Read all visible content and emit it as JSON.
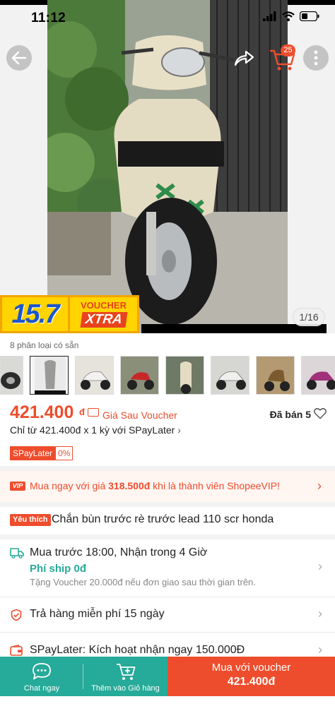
{
  "status_bar": {
    "time": "11:12"
  },
  "header": {
    "cart_count": "25"
  },
  "hero": {
    "promo_date": "15.7",
    "promo_voucher_top": "VOUCHER",
    "promo_voucher_bottom": "XTRA",
    "image_counter": "1/16"
  },
  "variants": {
    "label": "8 phân loại có sẵn"
  },
  "price": {
    "amount": "421.400",
    "currency": "đ",
    "after_voucher_label": "Giá Sau Voucher",
    "sold": "Đã bán 5",
    "installment": "Chỉ từ 421.400đ x 1 kỳ với SPayLater",
    "spaylater_badge": "SPayLater",
    "spaylater_rate": "0%"
  },
  "vip": {
    "tag": "VIP",
    "text_before": "Mua ngay với giá ",
    "price": "318.500đ",
    "text_after": " khi là thành viên ShopeeVIP!"
  },
  "product": {
    "fav_tag": "Yêu thích",
    "title": "Chắn bùn trước rè trước lead 110 scr honda"
  },
  "shipping": {
    "line1": "Mua trước 18:00, Nhận trong 4 Giờ",
    "fee": "Phí ship 0đ",
    "note": "Tặng Voucher 20.000đ nếu đơn giao sau thời gian trên."
  },
  "returns": {
    "text": "Trả hàng miễn phí 15 ngày"
  },
  "spaylater_row": {
    "text": "SPayLater: Kích hoạt nhận ngay 150.000Đ"
  },
  "bottom_bar": {
    "chat_label": "Chat ngay",
    "cart_label": "Thêm vào Giỏ hàng",
    "buy_line1": "Mua với voucher",
    "buy_line2": "421.400đ"
  },
  "colors": {
    "accent": "#ee4d2d",
    "teal": "#26aa99"
  }
}
